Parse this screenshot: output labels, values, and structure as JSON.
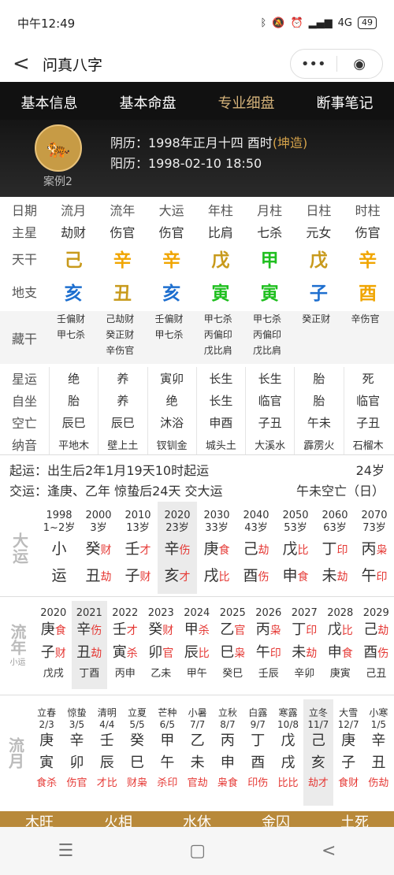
{
  "status": {
    "time": "中午12:49",
    "signal": "4G",
    "battery": "49"
  },
  "nav": {
    "back": "<",
    "title": "问真八字",
    "more": "•••",
    "target": "◉"
  },
  "tabs": [
    "基本信息",
    "基本命盘",
    "专业细盘",
    "断事笔记"
  ],
  "profile": {
    "case": "案例2",
    "lunar": "阴历：1998年正月十四 酉时",
    "lunar_tag": "(坤造)",
    "solar": "阳历：1998-02-10 18:50"
  },
  "header": {
    "labels": [
      "日期",
      "流月",
      "流年",
      "大运",
      "年柱",
      "月柱",
      "日柱",
      "时柱"
    ]
  },
  "stars": {
    "label": "主星",
    "vals": [
      "劫财",
      "伤官",
      "伤官",
      "比肩",
      "七杀",
      "元女",
      "伤官"
    ]
  },
  "tiangan": {
    "label": "天干",
    "vals": [
      "己",
      "辛",
      "辛",
      "戊",
      "甲",
      "戊",
      "辛"
    ]
  },
  "dizhi": {
    "label": "地支",
    "vals": [
      "亥",
      "丑",
      "亥",
      "寅",
      "寅",
      "子",
      "酉"
    ]
  },
  "canggan": {
    "label": "藏干",
    "cols": [
      [
        "壬偏财",
        "甲七杀"
      ],
      [
        "己劫财",
        "癸正财",
        "辛伤官"
      ],
      [
        "壬偏财",
        "甲七杀"
      ],
      [
        "甲七杀",
        "丙偏印",
        "戊比肩"
      ],
      [
        "甲七杀",
        "丙偏印",
        "戊比肩"
      ],
      [
        "癸正财"
      ],
      [
        "辛伤官"
      ]
    ]
  },
  "xingyun": {
    "label": "星运",
    "vals": [
      "绝",
      "养",
      "寅卯",
      "长生",
      "长生",
      "胎",
      "死"
    ]
  },
  "zizuo": {
    "label": "自坐",
    "vals": [
      "胎",
      "养",
      "绝",
      "长生",
      "临官",
      "胎",
      "临官"
    ]
  },
  "kongwang": {
    "label": "空亡",
    "vals": [
      "辰巳",
      "辰巳",
      "沐浴",
      "申酉",
      "子丑",
      "午未",
      "子丑"
    ]
  },
  "nayin": {
    "label": "纳音",
    "vals": [
      "平地木",
      "壁上土",
      "钗钏金",
      "城头土",
      "大溪水",
      "霹雳火",
      "石榴木"
    ]
  },
  "qiyun": {
    "text": "起运：出生后2年1月19天10时起运",
    "age": "24岁"
  },
  "jiaoyun": {
    "text": "交运：逢庚、乙年 惊蛰后24天 交大运",
    "kong": "午未空亡（日）"
  },
  "dayun": {
    "side": "大运",
    "cells": [
      {
        "y": "1998",
        "a": "1~2岁",
        "g": "小",
        "z": "运",
        "gs": "",
        "zs": ""
      },
      {
        "y": "2000",
        "a": "3岁",
        "g": "癸",
        "z": "丑",
        "gs": "财",
        "zs": "劫"
      },
      {
        "y": "2010",
        "a": "13岁",
        "g": "壬",
        "z": "子",
        "gs": "才",
        "zs": "财"
      },
      {
        "y": "2020",
        "a": "23岁",
        "g": "辛",
        "z": "亥",
        "gs": "伤",
        "zs": "才"
      },
      {
        "y": "2030",
        "a": "33岁",
        "g": "庚",
        "z": "戌",
        "gs": "食",
        "zs": "比"
      },
      {
        "y": "2040",
        "a": "43岁",
        "g": "己",
        "z": "酉",
        "gs": "劫",
        "zs": "伤"
      },
      {
        "y": "2050",
        "a": "53岁",
        "g": "戊",
        "z": "申",
        "gs": "比",
        "zs": "食"
      },
      {
        "y": "2060",
        "a": "63岁",
        "g": "丁",
        "z": "未",
        "gs": "印",
        "zs": "劫"
      },
      {
        "y": "2070",
        "a": "73岁",
        "g": "丙",
        "z": "午",
        "gs": "枭",
        "zs": "印"
      }
    ]
  },
  "liunian": {
    "side": "流年",
    "sub": "小运",
    "cells": [
      {
        "y": "2020",
        "g": "庚",
        "gs": "食",
        "z": "子",
        "zs": "财",
        "x": "戊戌"
      },
      {
        "y": "2021",
        "g": "辛",
        "gs": "伤",
        "z": "丑",
        "zs": "劫",
        "x": "丁酉"
      },
      {
        "y": "2022",
        "g": "壬",
        "gs": "才",
        "z": "寅",
        "zs": "杀",
        "x": "丙申"
      },
      {
        "y": "2023",
        "g": "癸",
        "gs": "财",
        "z": "卯",
        "zs": "官",
        "x": "乙未"
      },
      {
        "y": "2024",
        "g": "甲",
        "gs": "杀",
        "z": "辰",
        "zs": "比",
        "x": "甲午"
      },
      {
        "y": "2025",
        "g": "乙",
        "gs": "官",
        "z": "巳",
        "zs": "枭",
        "x": "癸巳"
      },
      {
        "y": "2026",
        "g": "丙",
        "gs": "枭",
        "z": "午",
        "zs": "印",
        "x": "壬辰"
      },
      {
        "y": "2027",
        "g": "丁",
        "gs": "印",
        "z": "未",
        "zs": "劫",
        "x": "辛卯"
      },
      {
        "y": "2028",
        "g": "戊",
        "gs": "比",
        "z": "申",
        "zs": "食",
        "x": "庚寅"
      },
      {
        "y": "2029",
        "g": "己",
        "gs": "劫",
        "z": "酉",
        "zs": "伤",
        "x": "己丑"
      }
    ]
  },
  "liuyue": {
    "side": "流月",
    "cells": [
      {
        "j": "立春",
        "d": "2/3",
        "g": "庚",
        "z": "寅",
        "s": "食杀"
      },
      {
        "j": "惊蛰",
        "d": "3/5",
        "g": "辛",
        "z": "卯",
        "s": "伤官"
      },
      {
        "j": "清明",
        "d": "4/4",
        "g": "壬",
        "z": "辰",
        "s": "才比"
      },
      {
        "j": "立夏",
        "d": "5/5",
        "g": "癸",
        "z": "巳",
        "s": "财枭"
      },
      {
        "j": "芒种",
        "d": "6/5",
        "g": "甲",
        "z": "午",
        "s": "杀印"
      },
      {
        "j": "小暑",
        "d": "7/7",
        "g": "乙",
        "z": "未",
        "s": "官劫"
      },
      {
        "j": "立秋",
        "d": "8/7",
        "g": "丙",
        "z": "申",
        "s": "枭食"
      },
      {
        "j": "白露",
        "d": "9/7",
        "g": "丁",
        "z": "酉",
        "s": "印伤"
      },
      {
        "j": "寒露",
        "d": "10/8",
        "g": "戊",
        "z": "戌",
        "s": "比比"
      },
      {
        "j": "立冬",
        "d": "11/7",
        "g": "己",
        "z": "亥",
        "s": "劫才"
      },
      {
        "j": "大雪",
        "d": "12/7",
        "g": "庚",
        "z": "子",
        "s": "食财"
      },
      {
        "j": "小寒",
        "d": "1/5",
        "g": "辛",
        "z": "丑",
        "s": "伤劫"
      }
    ]
  },
  "footer": [
    "木旺",
    "火相",
    "水休",
    "金囚",
    "土死"
  ],
  "sysnav": [
    "☰",
    "▢",
    "<"
  ]
}
